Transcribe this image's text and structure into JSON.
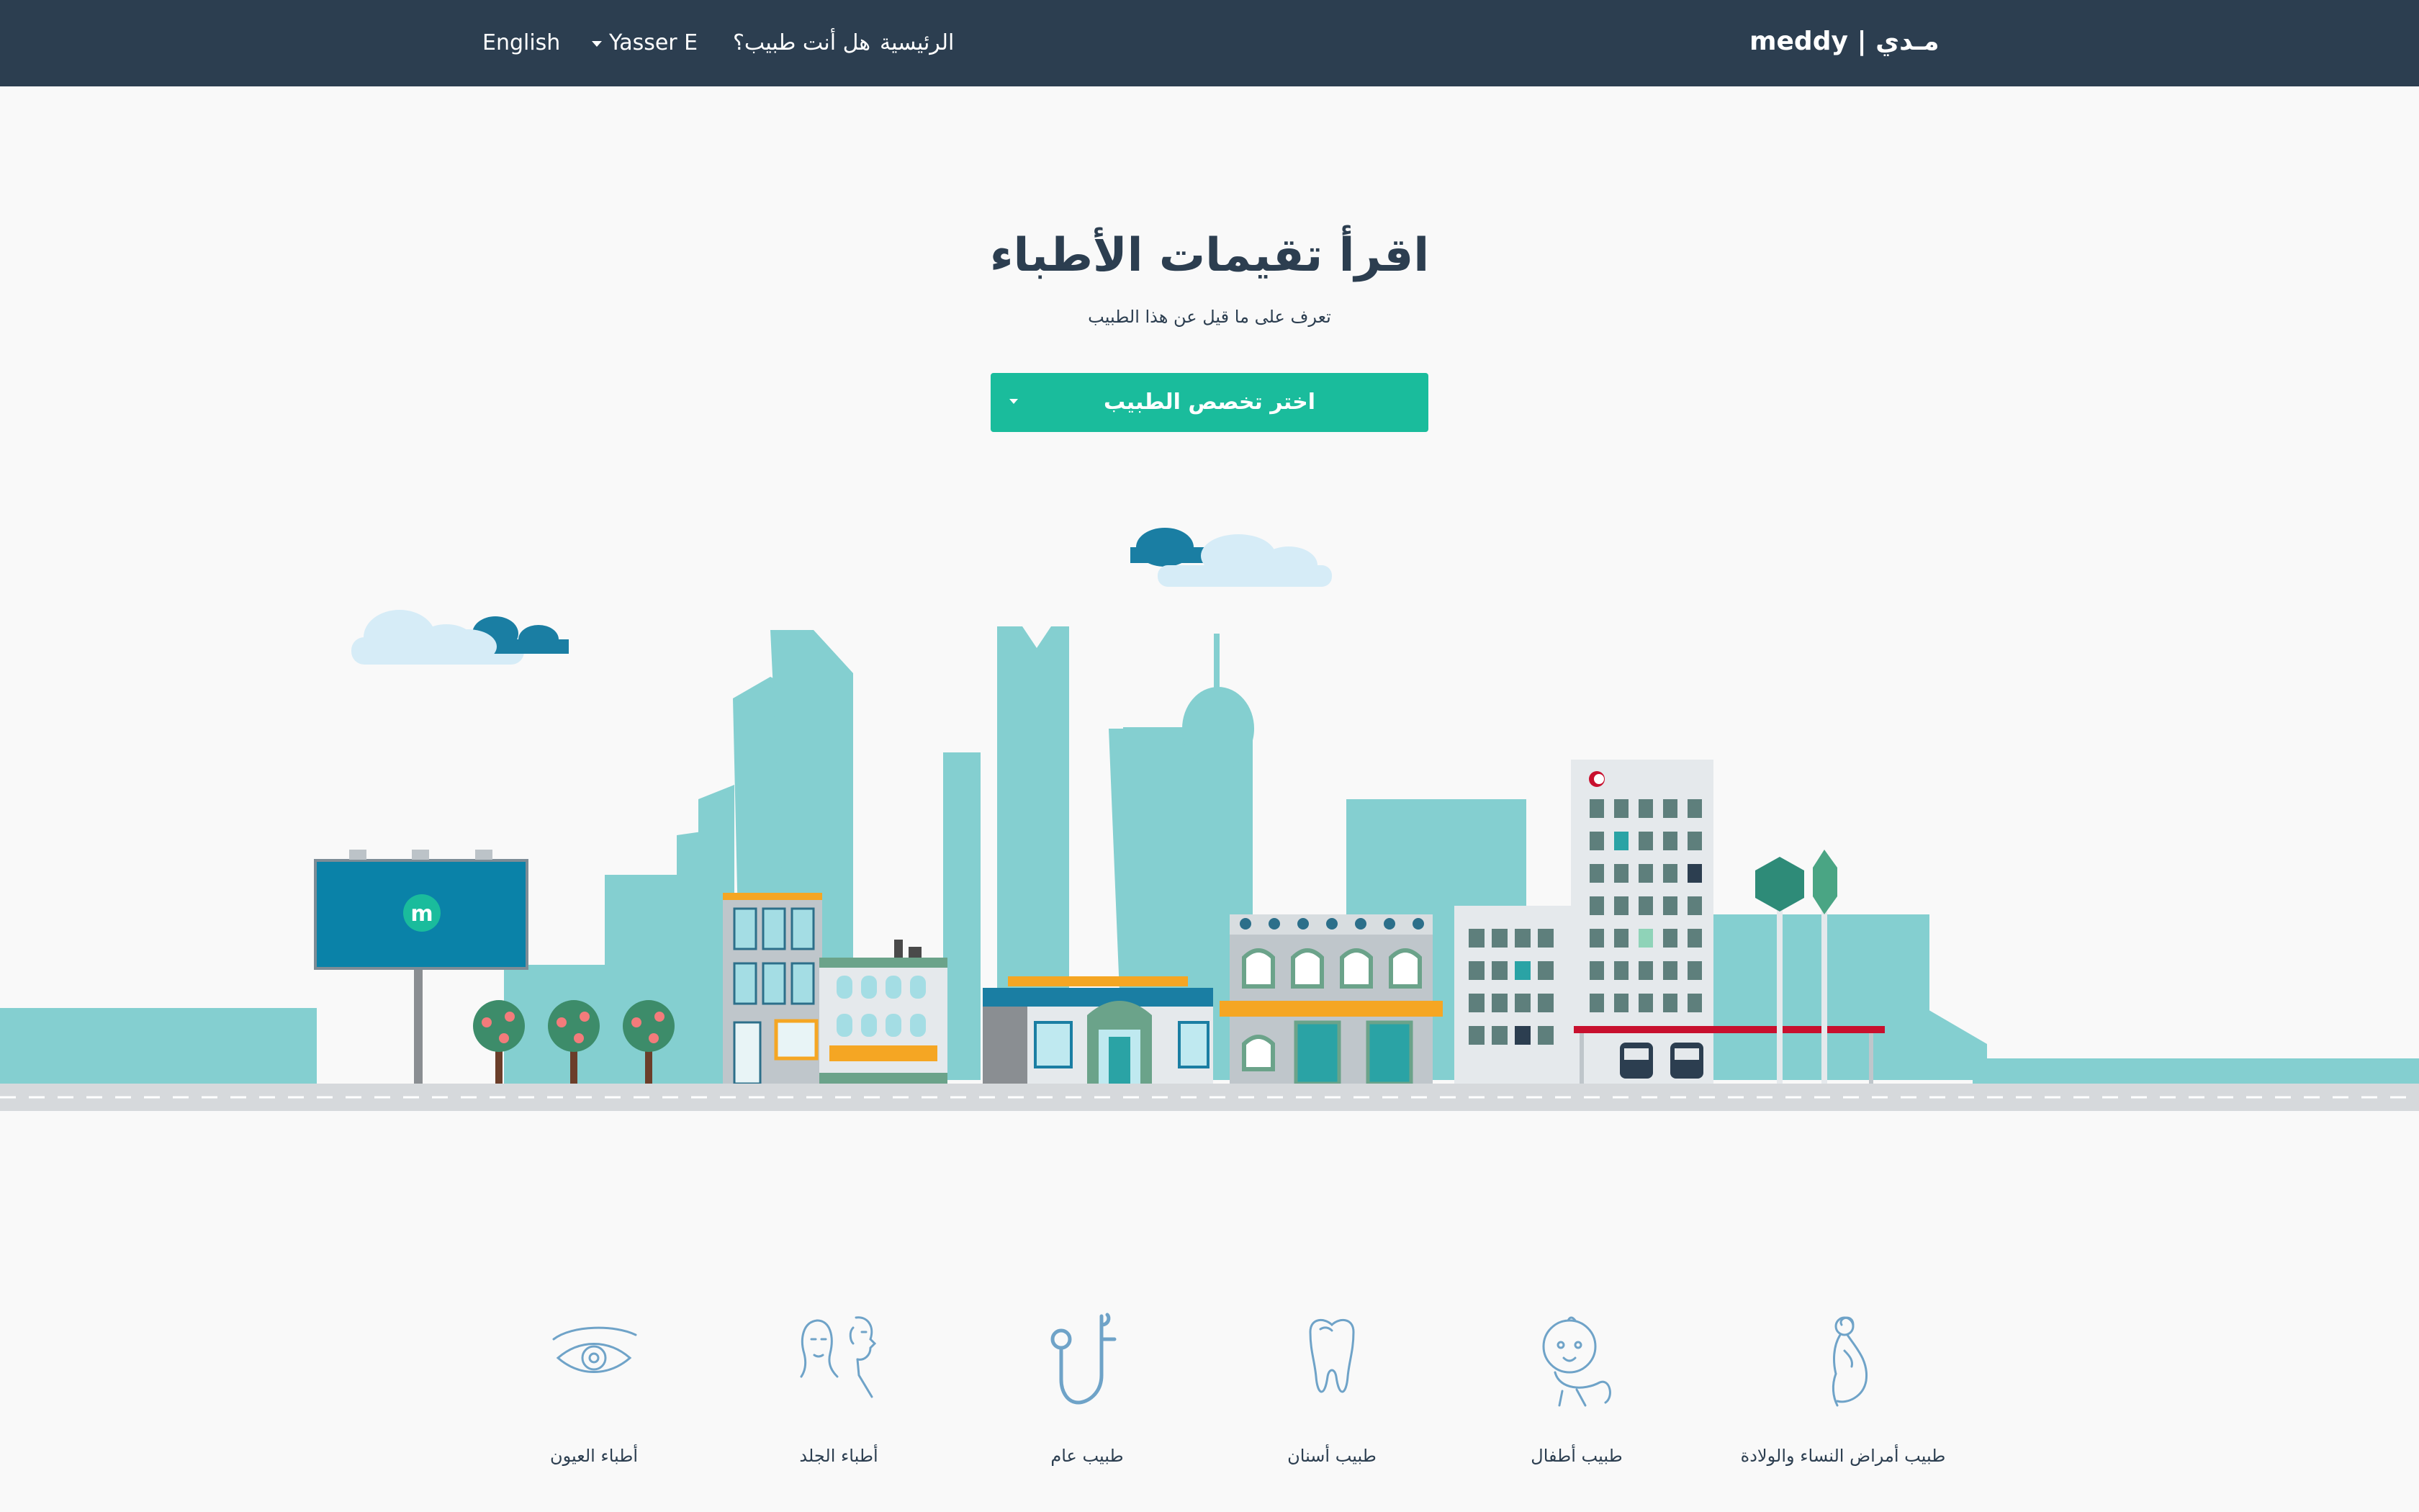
{
  "navbar": {
    "brand": "meddy | مـدي",
    "links": {
      "home": "الرئيسية",
      "are_you_doctor": "هل أنت طبيب؟",
      "user": "Yasser E",
      "language": "English"
    }
  },
  "hero": {
    "title": "اقرأ تقيمات الأطباء",
    "subtitle": "تعرف على ما قيل عن هذا الطبيب",
    "select_label": "اختر تخصص الطبيب"
  },
  "billboard": {
    "logo_letter": "m"
  },
  "specialties": [
    {
      "label": "طبيب أمراض النساء والولادة",
      "icon": "pregnant-woman-icon"
    },
    {
      "label": "طبيب أطفال",
      "icon": "baby-icon"
    },
    {
      "label": "طبيب أسنان",
      "icon": "tooth-icon"
    },
    {
      "label": "طبيب عام",
      "icon": "stethoscope-icon"
    },
    {
      "label": "أطباء الجلد",
      "icon": "faces-icon"
    },
    {
      "label": "أطباء العيون",
      "icon": "eye-icon"
    }
  ],
  "colors": {
    "navbar": "#2c3e50",
    "accent": "#1abc9c",
    "skyline": "#84cfd0",
    "text": "#2c3e50",
    "icon_stroke": "#6fa3c8"
  }
}
